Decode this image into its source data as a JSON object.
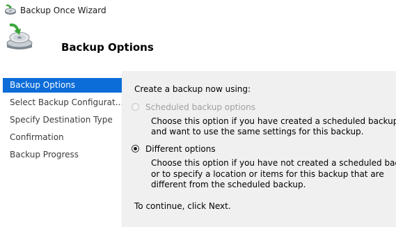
{
  "window": {
    "title": "Backup Once Wizard",
    "icon": "backup-wizard-icon"
  },
  "header": {
    "title": "Backup Options",
    "icon": "backup-disk-icon"
  },
  "sidebar": {
    "items": [
      {
        "label": "Backup Options",
        "active": true
      },
      {
        "label": "Select Backup Configurat...",
        "active": false
      },
      {
        "label": "Specify Destination Type",
        "active": false
      },
      {
        "label": "Confirmation",
        "active": false
      },
      {
        "label": "Backup Progress",
        "active": false
      }
    ],
    "active_color": "#0c6cd8"
  },
  "main": {
    "intro": "Create a backup now using:",
    "options": [
      {
        "label": "Scheduled backup options",
        "enabled": false,
        "selected": false,
        "description": [
          "Choose this option if you have created a scheduled backup",
          "and want to use the same settings for this backup."
        ]
      },
      {
        "label": "Different options",
        "enabled": true,
        "selected": true,
        "description": [
          "Choose this option if you have not created a scheduled backup",
          "or to specify a location or items for this backup that are",
          "different from the scheduled backup."
        ]
      }
    ],
    "footer": "To continue, click Next."
  }
}
